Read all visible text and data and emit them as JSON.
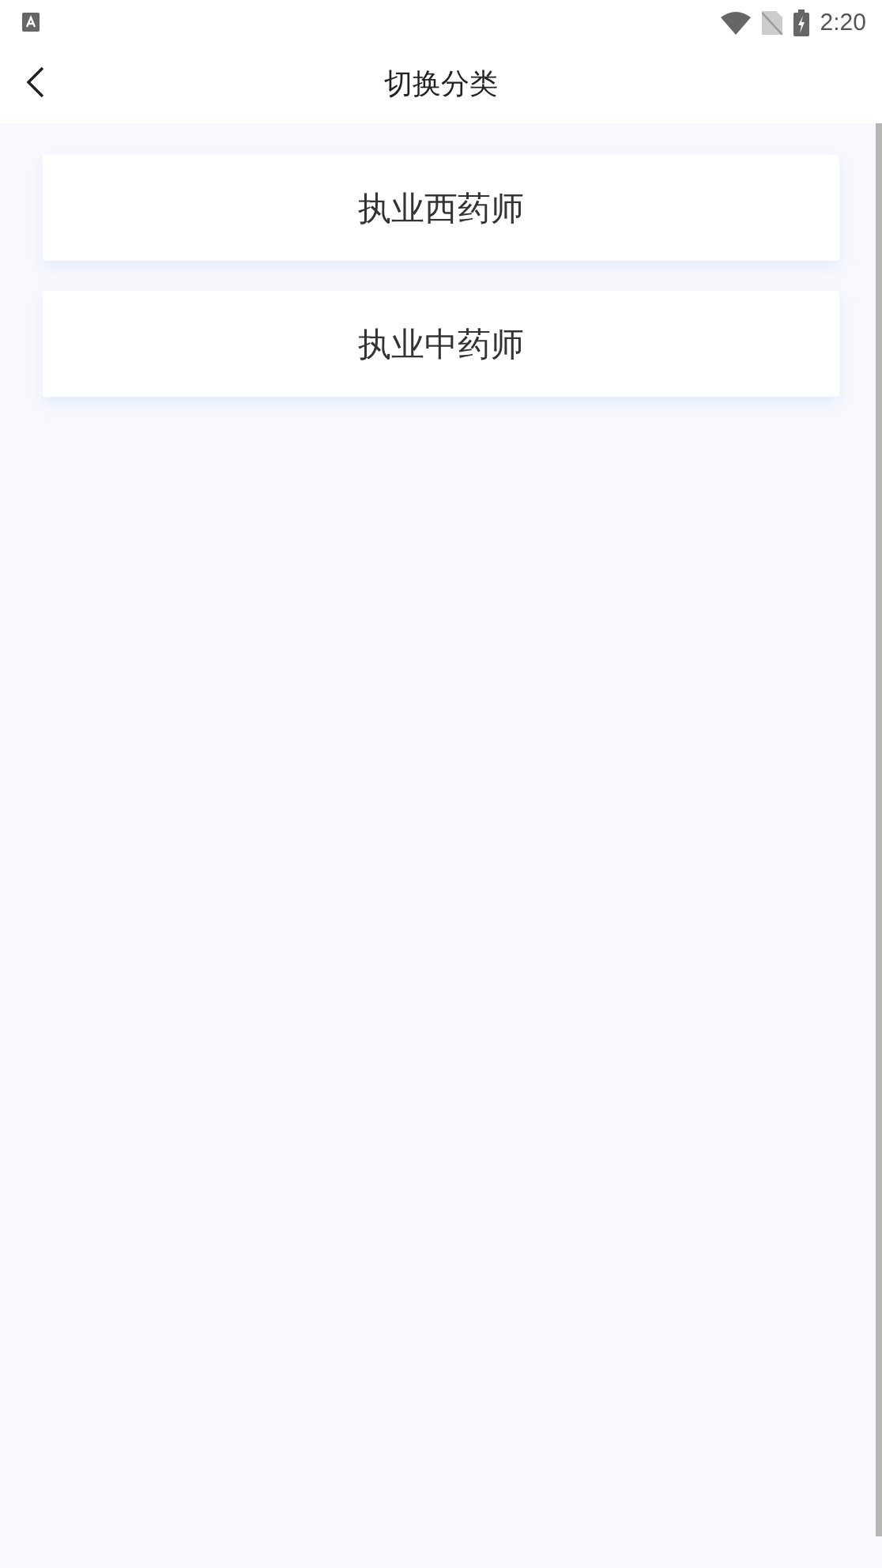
{
  "status_bar": {
    "time": "2:20"
  },
  "header": {
    "title": "切换分类"
  },
  "categories": [
    {
      "label": "执业西药师"
    },
    {
      "label": "执业中药师"
    }
  ]
}
